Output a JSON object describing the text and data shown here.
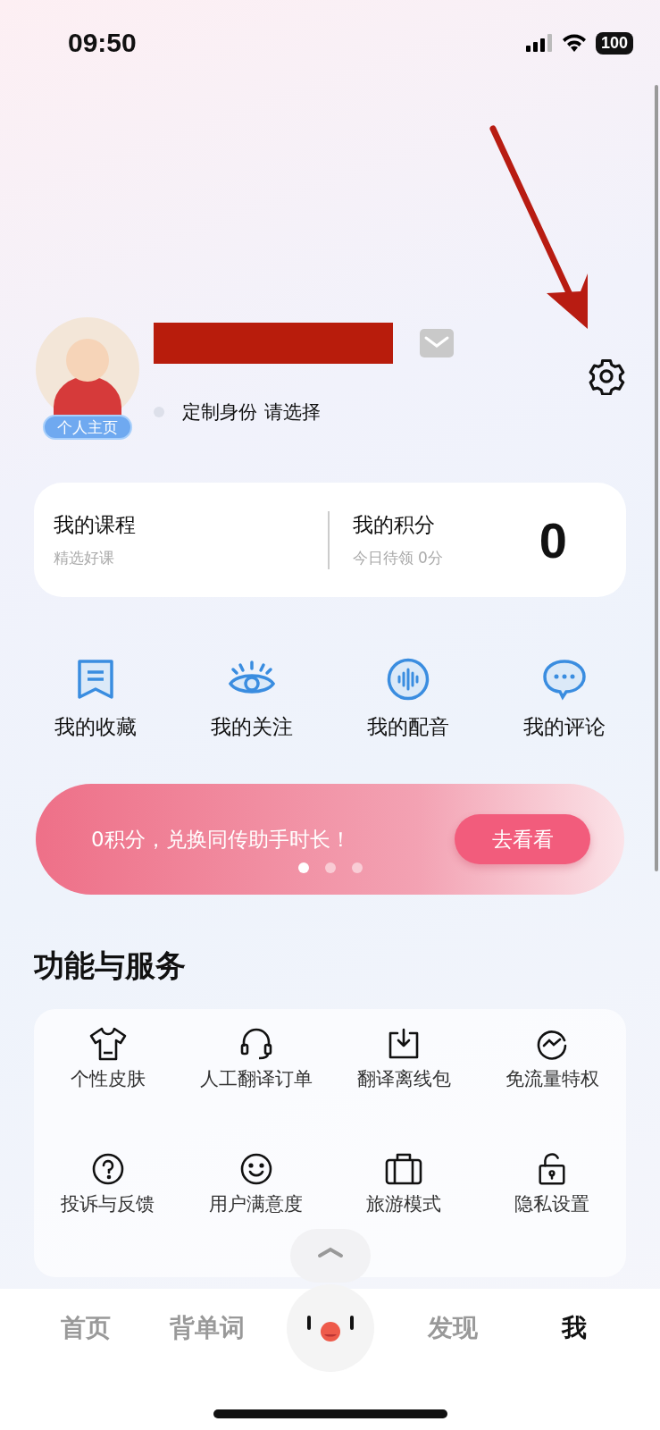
{
  "status_bar": {
    "time": "09:50",
    "battery": "100"
  },
  "profile": {
    "badge": "个人主页",
    "identity_label": "定制身份",
    "identity_value": "请选择"
  },
  "stats": [
    {
      "title": "我的课程",
      "subtitle": "精选好课"
    },
    {
      "title": "我的积分",
      "subtitle": "今日待领 0分",
      "value": "0"
    }
  ],
  "quick_links": [
    {
      "label": "我的收藏"
    },
    {
      "label": "我的关注"
    },
    {
      "label": "我的配音"
    },
    {
      "label": "我的评论"
    }
  ],
  "banner": {
    "text": "0积分，兑换同传助手时长！",
    "button": "去看看",
    "dots": [
      {
        "selected": true
      },
      {
        "selected": false
      },
      {
        "selected": false
      }
    ]
  },
  "services": {
    "title": "功能与服务",
    "items": [
      {
        "label": "个性皮肤"
      },
      {
        "label": "人工翻译订单"
      },
      {
        "label": "翻译离线包"
      },
      {
        "label": "免流量特权"
      },
      {
        "label": "投诉与反馈"
      },
      {
        "label": "用户满意度"
      },
      {
        "label": "旅游模式"
      },
      {
        "label": "隐私设置"
      }
    ]
  },
  "tab_bar": [
    {
      "label": "首页",
      "selected": false
    },
    {
      "label": "背单词",
      "selected": false
    },
    {
      "label": "发现",
      "selected": false
    },
    {
      "label": "我",
      "selected": true
    }
  ]
}
